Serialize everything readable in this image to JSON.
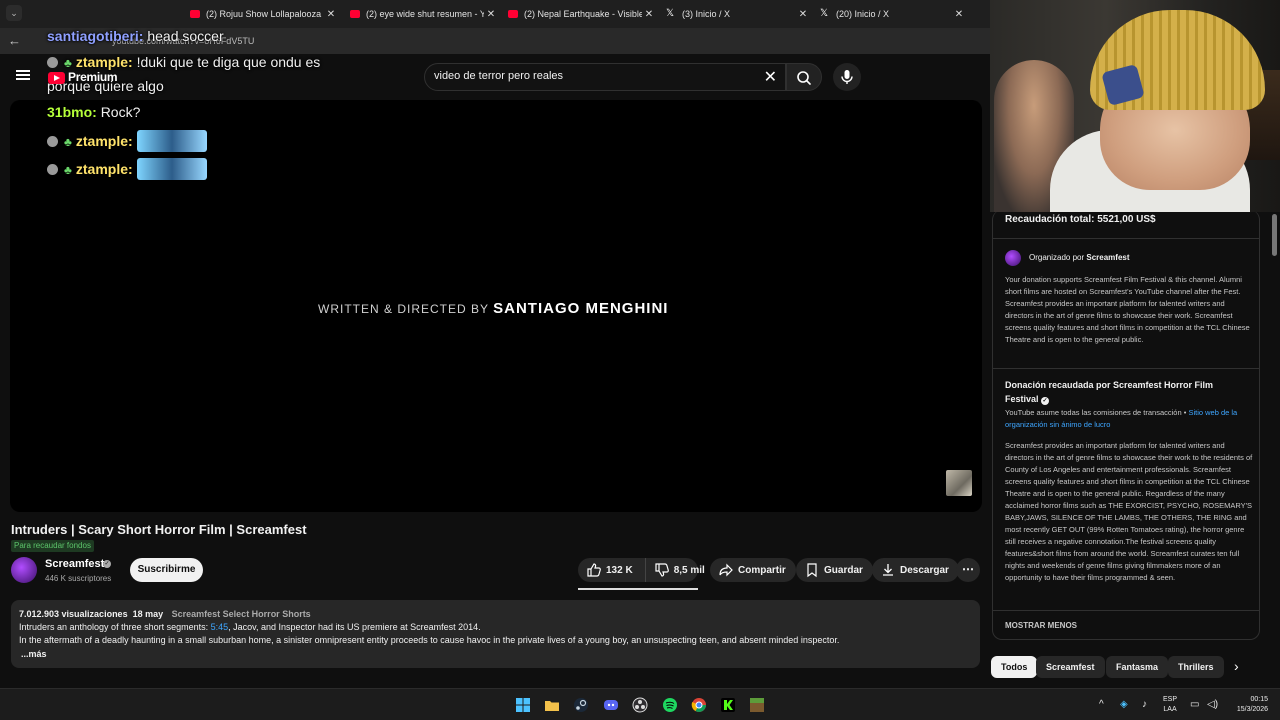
{
  "browser": {
    "tabs": [
      {
        "title": "(2) Rojuu Show Lollapalooza ar",
        "icon": "youtube-favicon"
      },
      {
        "title": "(2) eye wide shut resumen - Yo",
        "icon": "youtube-favicon"
      },
      {
        "title": "(2) Nepal Earthquake - Visible l",
        "icon": "youtube-favicon"
      },
      {
        "title": "(3) Inicio / X",
        "icon": "x-favicon"
      },
      {
        "title": "(20) Inicio / X",
        "icon": "x-favicon"
      }
    ],
    "url": "youtube.com/watch?v=oH6FdV5TU"
  },
  "chat": {
    "messages": [
      {
        "user": "santiagotiberi",
        "text": "head soccer"
      },
      {
        "user": "ztample",
        "text": "!duki que te diga que ondu es"
      },
      {
        "user": "",
        "text": "porque quiere algo"
      },
      {
        "user": "31bmo",
        "text": "Rock?"
      },
      {
        "user": "ztample",
        "text": ""
      },
      {
        "user": "ztample",
        "text": ""
      }
    ],
    "premium_label": "Premium"
  },
  "search": {
    "value": "video de terror pero reales"
  },
  "video": {
    "credit_prefix": "WRITTEN & DIRECTED BY",
    "credit_name": "SANTIAGO MENGHINI",
    "title": "Intruders | Scary Short Horror Film | Screamfest",
    "fund_tag": "Para recaudar fondos"
  },
  "channel": {
    "name": "Screamfest",
    "subscribers": "446 K suscriptores",
    "subscribe_label": "Suscribirme"
  },
  "actions": {
    "likes": "132 K",
    "dislikes": "8,5 mil",
    "share": "Compartir",
    "save": "Guardar",
    "download": "Descargar"
  },
  "description": {
    "views": "7.012.903 visualizaciones",
    "date": "18 may",
    "playlist": "Screamfest Select Horror Shorts",
    "line1_pre": "Intruders an anthology of three short segments: ",
    "line1_ts": "5:45",
    "line1_post": ", Jacov, and Inspector had its US premiere at Screamfest 2014.",
    "line2": "In the aftermath of a deadly haunting in a small suburban home, a sinister omnipresent entity proceeds to cause havoc in the private lives of a young boy, an unsuspecting teen, and absent minded inspector.",
    "more": "...más"
  },
  "fundraiser": {
    "total": "Recaudación total: 5521,00 US$",
    "organized_by_prefix": "Organizado por ",
    "organized_by_name": "Screamfest",
    "about": "Your donation supports Screamfest Film Festival & this channel. Alumni short films are hosted on Screamfest's YouTube channel after the Fest. Screamfest provides an important platform for talented writers and directors in the art of genre films to showcase their work. Screamfest screens quality features and short films in competition at the TCL Chinese Theatre and is open to the general public.",
    "donation_title": "Donación recaudada por Screamfest Horror Film Festival",
    "donation_sub": "YouTube asume todas las comisiones de transacción •",
    "donation_link": "Sitio web de la organización sin ánimo de lucro",
    "long_text": "Screamfest provides an important platform for talented writers and directors in the art of genre films to showcase their work to the residents of County of Los Angeles and entertainment professionals. Screamfest screens quality features and short films in competition at the TCL Chinese Theatre and is open to the general public. Regardless of the many acclaimed horror films such as THE EXORCIST, PSYCHO, ROSEMARY'S BABY,JAWS, SILENCE OF THE LAMBS, THE OTHERS, THE RING and most recently GET OUT (99% Rotten Tomatoes rating), the horror genre still receives a negative connotation.The festival screens quality features&short films from around the world. Screamfest curates ten full nights and weekends of genre films giving filmmakers more of an opportunity to have their films programmed & seen.",
    "show_less": "MOSTRAR MENOS"
  },
  "chips": [
    "Todos",
    "Screamfest",
    "Fantasma",
    "Thrillers"
  ],
  "taskbar": {
    "lang_line1": "ESP",
    "lang_line2": "LAA",
    "time": "00:15",
    "date": "15/3/2026"
  }
}
